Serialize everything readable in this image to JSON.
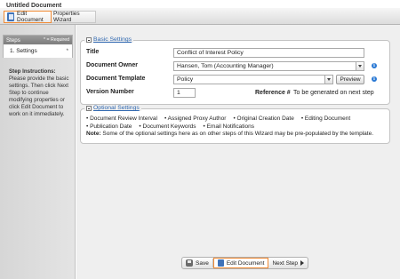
{
  "window": {
    "title": "Untitled Document"
  },
  "toolbar": {
    "edit_document": "Edit Document",
    "properties_wizard": "Properties Wizard"
  },
  "steps": {
    "header": "Steps",
    "required_note": "* = Required",
    "items": [
      {
        "label": "1. Settings",
        "marker": "*"
      }
    ],
    "instructions_title": "Step Instructions:",
    "instructions_text": "Please provide the basic settings. Then click Next Step to continue modifying properties or click Edit Document to work on it immediately."
  },
  "basic_settings": {
    "legend": "Basic Settings",
    "title_label": "Title",
    "title_value": "Conflict of Interest Policy",
    "owner_label": "Document Owner",
    "owner_value": "Hansen, Tom (Accounting Manager)",
    "template_label": "Document Template",
    "template_value": "Policy",
    "preview_label": "Preview",
    "version_label": "Version Number",
    "version_value": "1",
    "reference_label": "Reference #",
    "reference_value": "To be generated on next step"
  },
  "optional_settings": {
    "legend": "Optional Settings",
    "row1": [
      "• Document Review Interval",
      "• Assigned Proxy Author",
      "• Original Creation Date",
      "• Editing Document"
    ],
    "row2": [
      "• Publication Date",
      "• Document Keywords",
      "• Email Notifications"
    ],
    "note_label": "Note:",
    "note_text": "Some of the optional settings here as on other steps of this Wizard may be pre-populated by the template."
  },
  "footer": {
    "save": "Save",
    "edit_document": "Edit Document",
    "next_step": "Next Step"
  },
  "colors": {
    "highlight": "#f08a34",
    "link": "#3068b0",
    "info": "#2a79d4"
  }
}
